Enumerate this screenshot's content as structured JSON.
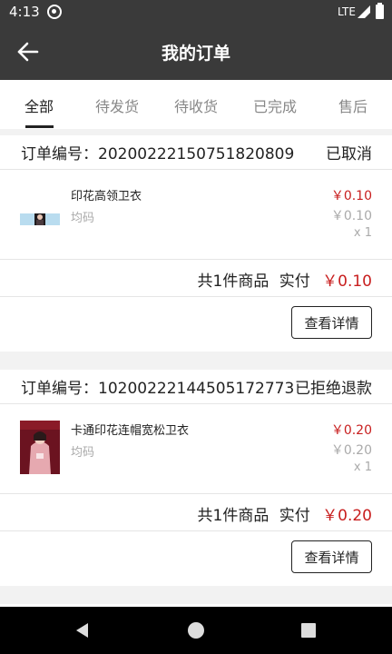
{
  "status_bar": {
    "time": "4:13",
    "network": "LTE",
    "icons": [
      "app-notification-icon",
      "signal-icon",
      "battery-icon"
    ]
  },
  "header": {
    "title": "我的订单",
    "back_icon": "arrow-left-icon"
  },
  "tabs": [
    {
      "label": "全部",
      "active": true
    },
    {
      "label": "待发货",
      "active": false
    },
    {
      "label": "待收货",
      "active": false
    },
    {
      "label": "已完成",
      "active": false
    },
    {
      "label": "售后",
      "active": false
    }
  ],
  "orders": [
    {
      "number": "订单编号：20200222150751820809",
      "status": "已取消",
      "product": {
        "name": "印花高领卫衣",
        "spec": "均码",
        "price": "￥0.10",
        "original_price": "￥0.10",
        "quantity": "x 1"
      },
      "summary": {
        "count_text": "共1件商品",
        "paid_label": "实付",
        "paid_amount": "￥0.10"
      },
      "detail_button": "查看详情"
    },
    {
      "number": "订单编号：10200222144505172773",
      "status": "已拒绝退款",
      "product": {
        "name": "卡通印花连帽宽松卫衣",
        "spec": "均码",
        "price": "￥0.20",
        "original_price": "￥0.20",
        "quantity": "x 1"
      },
      "summary": {
        "count_text": "共1件商品",
        "paid_label": "实付",
        "paid_amount": "￥0.20"
      },
      "detail_button": "查看详情"
    }
  ],
  "colors": {
    "header_bg": "#3a3a3a",
    "price_red": "#c81e1e",
    "muted_gray": "#aaaaaa"
  },
  "nav_bar": {
    "icons": [
      "nav-back-icon",
      "nav-home-icon",
      "nav-recent-apps-icon"
    ]
  }
}
